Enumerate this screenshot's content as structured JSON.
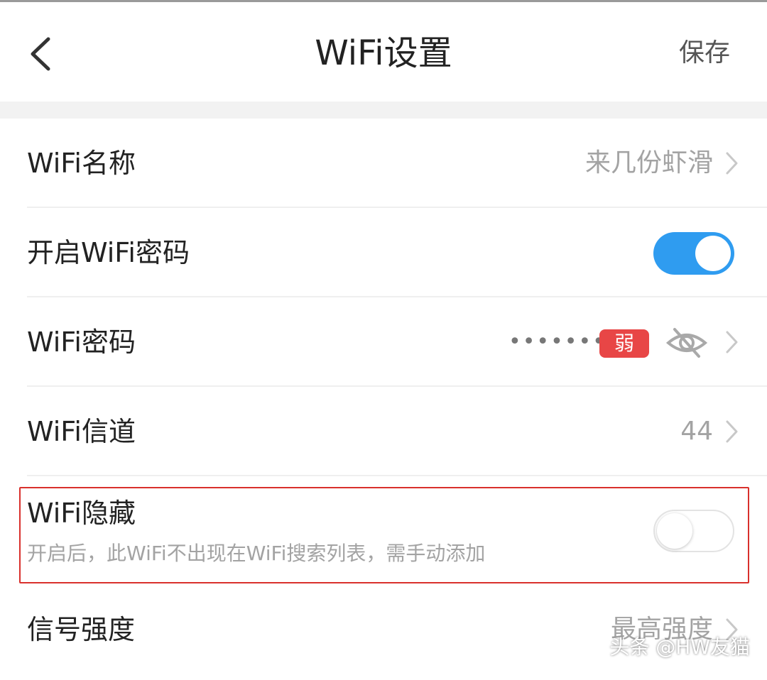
{
  "header": {
    "title": "WiFi设置",
    "save_label": "保存"
  },
  "rows": {
    "name": {
      "label": "WiFi名称",
      "value": "来几份虾滑"
    },
    "enable_password": {
      "label": "开启WiFi密码",
      "toggle_on": true
    },
    "password": {
      "label": "WiFi密码",
      "masked_value": "••••••••",
      "strength_badge": "弱"
    },
    "channel": {
      "label": "WiFi信道",
      "value": "44"
    },
    "hidden": {
      "label": "WiFi隐藏",
      "description": "开启后，此WiFi不出现在WiFi搜索列表，需手动添加",
      "toggle_on": false
    },
    "signal": {
      "label": "信号强度",
      "value": "最高强度"
    }
  },
  "watermark": "头条 @HW友猫",
  "colors": {
    "accent": "#2f9cf0",
    "weak_badge": "#e84646",
    "highlight_border": "#d9302c"
  },
  "icons": {
    "back": "back-arrow-icon",
    "chevron": "chevron-right-icon",
    "eye": "eye-hidden-icon"
  }
}
